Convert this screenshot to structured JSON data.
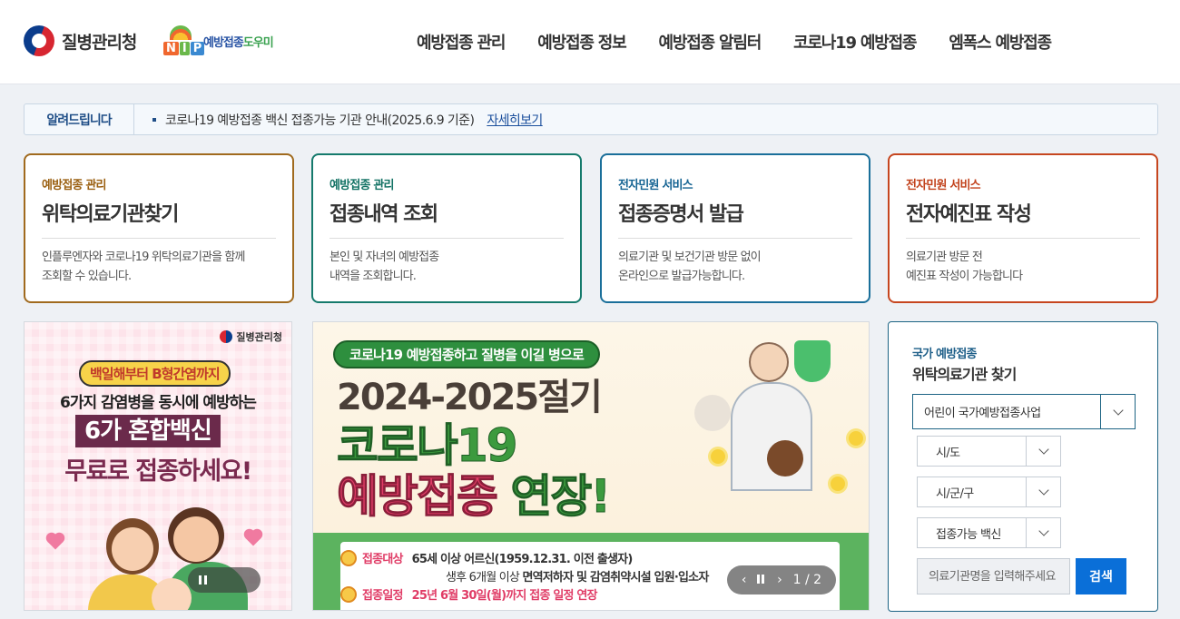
{
  "header": {
    "logo_text": "질병관리청",
    "nip_logo": {
      "letters": [
        "N",
        "I",
        "P"
      ],
      "text_a": "예방접종",
      "text_b": "도우미"
    },
    "nav": [
      {
        "label": "예방접종 관리"
      },
      {
        "label": "예방접종 정보"
      },
      {
        "label": "예방접종 알림터"
      },
      {
        "label": "코로나19 예방접종"
      },
      {
        "label": "엠폭스 예방접종"
      }
    ]
  },
  "notice": {
    "title": "알려드립니다",
    "text": "코로나19 예방접종 백신 접종가능 기관 안내(2025.6.9 기준)",
    "link": "자세히보기"
  },
  "cards": [
    {
      "category": "예방접종 관리",
      "title": "위탁의료기관찾기",
      "desc1": "인플루엔자와 코로나19 위탁의료기관을 함께",
      "desc2": "조회할 수 있습니다."
    },
    {
      "category": "예방접종 관리",
      "title": "접종내역 조회",
      "desc1": "본인 및 자녀의 예방접종",
      "desc2": "내역을 조회합니다."
    },
    {
      "category": "전자민원 서비스",
      "title": "접종증명서 발급",
      "desc1": "의료기관 및 보건기관 방문 없이",
      "desc2": "온라인으로 발급가능합니다."
    },
    {
      "category": "전자민원 서비스",
      "title": "전자예진표 작성",
      "desc1": "의료기관 방문 전",
      "desc2": "예진표 작성이 가능합니다"
    }
  ],
  "banner_left": {
    "brand": "질병관리청",
    "tag": "백일해부터 B형간염까지",
    "line1": "6가지 감염병을 동시에 예방하는",
    "line2": "6가 혼합백신",
    "line3": "무료로 접종하세요!"
  },
  "banner_center": {
    "pill": "코로나19 예방접종하고 질병을 이길 병으로",
    "year": "2024-2025절기",
    "title1": "코로나19",
    "title2a": "예방접종",
    "title2b": "연장!",
    "row1_label": "접종대상",
    "row1_text": "65세 이상 어르신(1959.12.31. 이전 출생자)",
    "row2_pre": "생후 6개월 이상",
    "row2_bold": "면역저하자 및 감염취약시설 입원·입소자",
    "row3_label": "접종일정",
    "row3_text": "25년 6월 30일(월)까지 접종 일정 연장",
    "pager": "1 / 2"
  },
  "search": {
    "subtitle": "국가 예방접종",
    "title": "위탁의료기관 찾기",
    "program_select": "어린이 국가예방접종사업",
    "sido_select": "시/도",
    "sigungu_select": "시/군/구",
    "vaccine_select": "접종가능 백신",
    "input_placeholder": "의료기관명을 입력해주세요",
    "button": "검색"
  },
  "colors": {
    "card1": "#a06a1e",
    "card2": "#157a6c",
    "card3": "#1a6f9a",
    "card4": "#c6461f",
    "search_button": "#0a6fd8"
  }
}
